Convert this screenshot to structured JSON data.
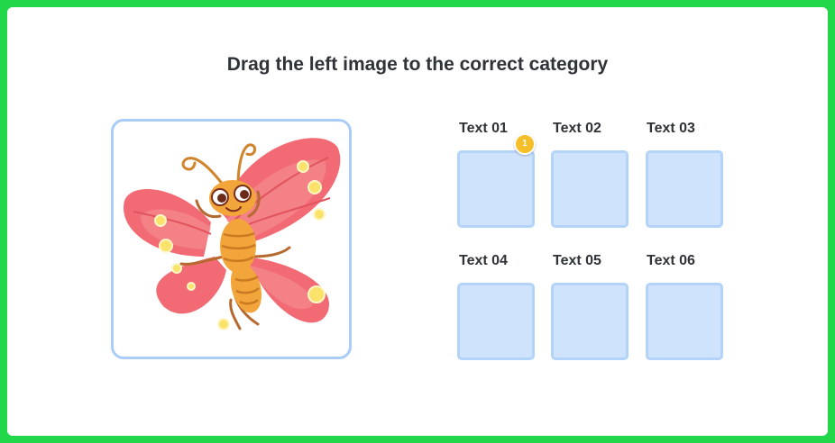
{
  "instruction": "Drag the left image to the correct category",
  "draggable_image": {
    "subject": "butterfly",
    "icon": "butterfly-illustration"
  },
  "slots": [
    {
      "label": "Text 01",
      "badge": "1"
    },
    {
      "label": "Text 02"
    },
    {
      "label": "Text 03"
    },
    {
      "label": "Text 04"
    },
    {
      "label": "Text 05"
    },
    {
      "label": "Text 06"
    }
  ],
  "colors": {
    "frame_border": "#22d84a",
    "slot_fill": "#cfe3fd",
    "slot_border": "#b3d3f8",
    "card_border": "#a9cdf7",
    "badge": "#f6bf29",
    "wing": "#f26b74",
    "body": "#f2a53a"
  }
}
